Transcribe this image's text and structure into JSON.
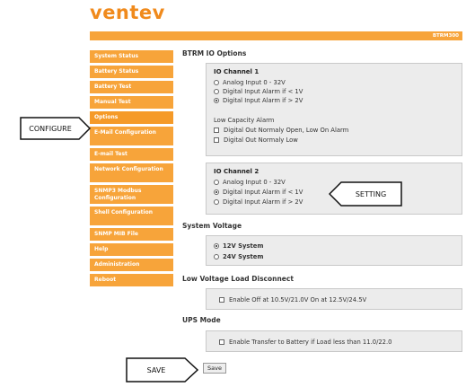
{
  "brand": {
    "logo_text": "ventev",
    "accent": "#f7a43a"
  },
  "topbar": {
    "label": "BTRM300"
  },
  "sidebar": {
    "items": [
      {
        "label": "System Status"
      },
      {
        "label": "Battery Status"
      },
      {
        "label": "Battery Test"
      },
      {
        "label": "Manual Test"
      },
      {
        "label": "Options"
      },
      {
        "label": "E-Mail Configuration"
      },
      {
        "label": "E-mail Test"
      },
      {
        "label": "Network Configuration"
      },
      {
        "label": "SNMP3 Modbus Configuration"
      },
      {
        "label": "Shell Configuration"
      },
      {
        "label": "SNMP MIB File"
      },
      {
        "label": "Help"
      },
      {
        "label": "Administration"
      },
      {
        "label": "Reboot"
      }
    ]
  },
  "main": {
    "title": "BTRM IO Options",
    "io1": {
      "title": "IO Channel 1",
      "options": [
        "Analog Input 0 - 32V",
        "Digital Input Alarm if < 1V",
        "Digital Input Alarm if > 2V"
      ],
      "selected": 2,
      "low_cap_title": "Low Capacity Alarm",
      "low_cap_options": [
        "Digital Out Normaly Open, Low On Alarm",
        "Digital Out Normaly Low"
      ]
    },
    "io2": {
      "title": "IO Channel 2",
      "options": [
        "Analog Input 0 - 32V",
        "Digital Input Alarm if < 1V",
        "Digital Input Alarm if > 2V"
      ],
      "selected": 1
    },
    "system_voltage": {
      "title": "System Voltage",
      "options": [
        "12V System",
        "24V System"
      ],
      "selected": 0
    },
    "lvld": {
      "title": "Low Voltage Load Disconnect",
      "checkbox_label": "Enable Off at 10.5V/21.0V On at 12.5V/24.5V"
    },
    "ups": {
      "title": "UPS Mode",
      "checkbox_label": "Enable Transfer to Battery if Load less than 11.0/22.0"
    },
    "save_label": "Save"
  },
  "annotations": {
    "configure": "CONFIGURE",
    "setting": "SETTING",
    "save": "SAVE"
  }
}
